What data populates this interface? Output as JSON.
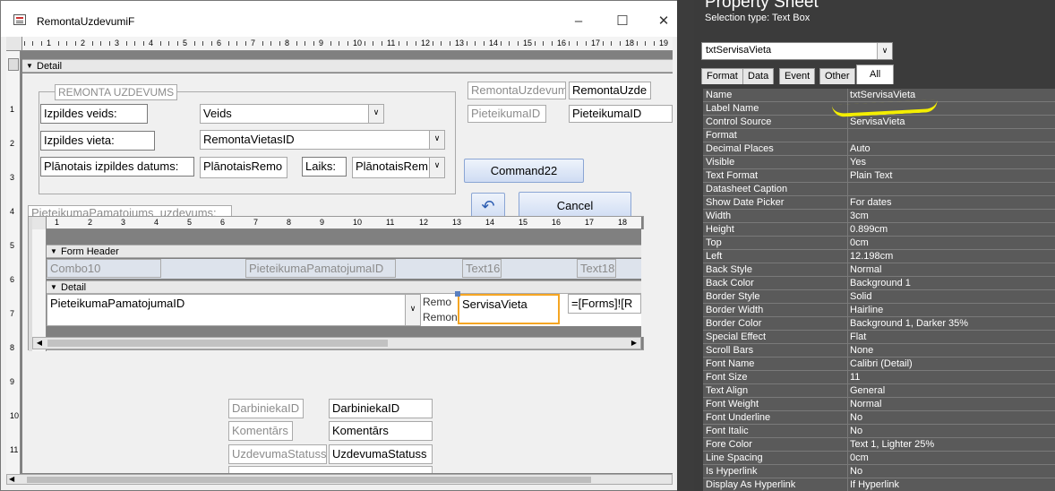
{
  "window": {
    "title": "RemontaUzdevumiF"
  },
  "sections": {
    "detail": "Detail",
    "form_header": "Form Header",
    "sub_detail": "Detail"
  },
  "ruler": {
    "h": [
      "1",
      "2",
      "3",
      "4",
      "5",
      "6",
      "7",
      "8",
      "9",
      "10",
      "11",
      "12",
      "13",
      "14",
      "15",
      "16",
      "17",
      "18",
      "19"
    ],
    "v": [
      "1",
      "2",
      "3",
      "4",
      "5",
      "6",
      "7",
      "8",
      "9",
      "10",
      "11"
    ],
    "sub_h": [
      "1",
      "2",
      "3",
      "4",
      "5",
      "6",
      "7",
      "8",
      "9",
      "10",
      "11",
      "12",
      "13",
      "14",
      "15",
      "16",
      "17",
      "18"
    ]
  },
  "form": {
    "group_label": "REMONTA UZDEVUMS",
    "izpildes_veids_label": "Izpildes veids:",
    "izpildes_veids_value": "Veids",
    "izpildes_vieta_label": "Izpildes vieta:",
    "izpildes_vieta_value": "RemontaVietasID",
    "planotais_label": "Plānotais izpildes datums:",
    "planotais_value": "PlānotaisRemo",
    "laiks_label": "Laiks:",
    "laiks_value": "PlānotaisRem",
    "remonta_label": "RemontaUzdevum",
    "remonta_value": "RemontaUzde",
    "pieteikuma_label": "PieteikumaID",
    "pieteikuma_value": "PieteikumaID",
    "command_label": "Command22",
    "undo_glyph": "↶",
    "cancel_label": "Cancel",
    "subform_label": "PieteikumaPamatojums_uzdevums:",
    "darbinieka_label": "DarbiniekaID",
    "darbinieka_value": "DarbiniekaID",
    "komentars_label": "Komentārs",
    "komentars_value": "Komentārs",
    "statuss_label": "UzdevumaStatuss",
    "statuss_value": "UzdevumaStatuss"
  },
  "subform": {
    "header_fields": [
      "Combo10",
      "PieteikumaPamatojumaID",
      "Text16",
      "Text18"
    ],
    "detail_combo": "PieteikumaPamatojumaID",
    "detail_mid": "RemontaUz",
    "detail_mid_top": "Remo",
    "detail_selected": "ServisaVieta",
    "detail_expr": "=[Forms]![R"
  },
  "property_sheet": {
    "title": "Property Sheet",
    "selection_type": "Selection type:  Text Box",
    "selected_object": "txtServisaVieta",
    "tabs": [
      "Format",
      "Data",
      "Event",
      "Other",
      "All"
    ],
    "active_tab": "All",
    "rows": [
      {
        "k": "Name",
        "v": "txtServisaVieta"
      },
      {
        "k": "Label Name",
        "v": ""
      },
      {
        "k": "Control Source",
        "v": "ServisaVieta"
      },
      {
        "k": "Format",
        "v": ""
      },
      {
        "k": "Decimal Places",
        "v": "Auto"
      },
      {
        "k": "Visible",
        "v": "Yes"
      },
      {
        "k": "Text Format",
        "v": "Plain Text"
      },
      {
        "k": "Datasheet Caption",
        "v": ""
      },
      {
        "k": "Show Date Picker",
        "v": "For dates"
      },
      {
        "k": "Width",
        "v": "3cm"
      },
      {
        "k": "Height",
        "v": "0.899cm"
      },
      {
        "k": "Top",
        "v": "0cm"
      },
      {
        "k": "Left",
        "v": "12.198cm"
      },
      {
        "k": "Back Style",
        "v": "Normal"
      },
      {
        "k": "Back Color",
        "v": "Background 1"
      },
      {
        "k": "Border Style",
        "v": "Solid"
      },
      {
        "k": "Border Width",
        "v": "Hairline"
      },
      {
        "k": "Border Color",
        "v": "Background 1, Darker 35%"
      },
      {
        "k": "Special Effect",
        "v": "Flat"
      },
      {
        "k": "Scroll Bars",
        "v": "None"
      },
      {
        "k": "Font Name",
        "v": "Calibri (Detail)"
      },
      {
        "k": "Font Size",
        "v": "11"
      },
      {
        "k": "Text Align",
        "v": "General"
      },
      {
        "k": "Font Weight",
        "v": "Normal"
      },
      {
        "k": "Font Underline",
        "v": "No"
      },
      {
        "k": "Font Italic",
        "v": "No"
      },
      {
        "k": "Fore Color",
        "v": "Text 1, Lighter 25%"
      },
      {
        "k": "Line Spacing",
        "v": "0cm"
      },
      {
        "k": "Is Hyperlink",
        "v": "No"
      },
      {
        "k": "Display As Hyperlink",
        "v": "If Hyperlink"
      }
    ]
  },
  "colors": {
    "highlight": "#f4ee00",
    "selection_border": "#f5a623"
  }
}
